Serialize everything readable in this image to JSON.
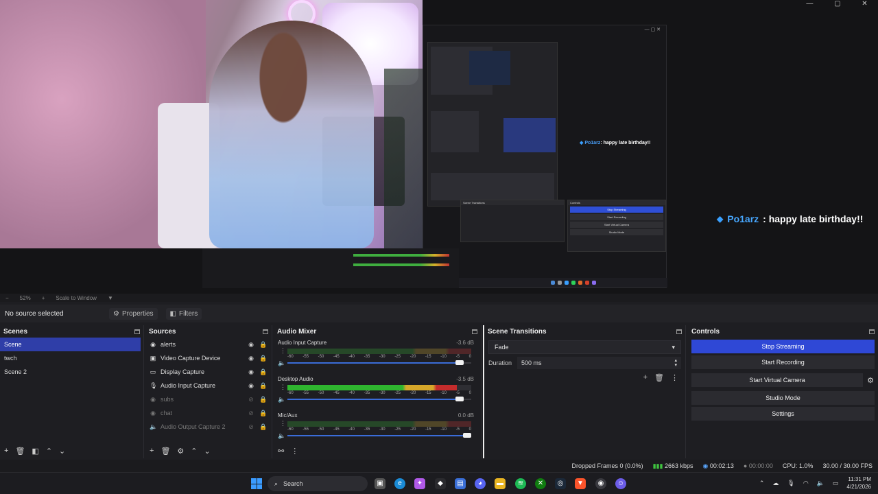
{
  "window": {
    "minimize": "—",
    "maximize": "▢",
    "close": "✕"
  },
  "overlay_chat": {
    "name": "Po1arz",
    "message": ": happy late birthday!!"
  },
  "nested_chat": {
    "name": "Po1arz",
    "message": ": happy late birthday!!"
  },
  "zoom": {
    "percent": "52%",
    "scale": "Scale to Window"
  },
  "context": {
    "no_source": "No source selected",
    "properties": "Properties",
    "filters": "Filters"
  },
  "scenes": {
    "title": "Scenes",
    "items": [
      {
        "label": "Scene",
        "selected": true
      },
      {
        "label": "twch",
        "selected": false
      },
      {
        "label": "Scene 2",
        "selected": false
      }
    ]
  },
  "sources": {
    "title": "Sources",
    "items": [
      {
        "label": "alerts",
        "icon": "browser-icon",
        "visible": true
      },
      {
        "label": "Video Capture Device",
        "icon": "camera-icon",
        "visible": true
      },
      {
        "label": "Display Capture",
        "icon": "monitor-icon",
        "visible": true
      },
      {
        "label": "Audio Input Capture",
        "icon": "mic-icon",
        "visible": true
      },
      {
        "label": "subs",
        "icon": "browser-icon",
        "visible": false
      },
      {
        "label": "chat",
        "icon": "browser-icon",
        "visible": false
      },
      {
        "label": "Audio Output Capture 2",
        "icon": "speaker-icon",
        "visible": false
      }
    ]
  },
  "mixer": {
    "title": "Audio Mixer",
    "ticks": [
      "-60",
      "-55",
      "-50",
      "-45",
      "-40",
      "-35",
      "-30",
      "-25",
      "-20",
      "-15",
      "-10",
      "-5",
      "0"
    ],
    "channels": [
      {
        "name": "Audio Input Capture",
        "db": "-3.6 dB",
        "level": 0.0,
        "volume": 0.96
      },
      {
        "name": "Desktop Audio",
        "db": "-3.5 dB",
        "level": 0.92,
        "volume": 0.96
      },
      {
        "name": "Mic/Aux",
        "db": "0.0 dB",
        "level": 0.0,
        "volume": 1.0
      }
    ]
  },
  "transitions": {
    "title": "Scene Transitions",
    "type": "Fade",
    "duration_label": "Duration",
    "duration": "500 ms"
  },
  "controls": {
    "title": "Controls",
    "stop_streaming": "Stop Streaming",
    "start_recording": "Start Recording",
    "start_virtual_camera": "Start Virtual Camera",
    "studio_mode": "Studio Mode",
    "settings": "Settings"
  },
  "status": {
    "dropped": "Dropped Frames 0 (0.0%)",
    "bitrate": "2663 kbps",
    "stream_time": "00:02:13",
    "rec_time": "00:00:00",
    "cpu": "CPU: 1.0%",
    "fps": "30.00 / 30.00 FPS"
  },
  "taskbar": {
    "search": "Search",
    "time": "11:31 PM",
    "date": "4/21/2026"
  },
  "colors": {
    "accent": "#2f48d6",
    "green": "#3fc43f",
    "chat_name": "#47a7ff"
  }
}
